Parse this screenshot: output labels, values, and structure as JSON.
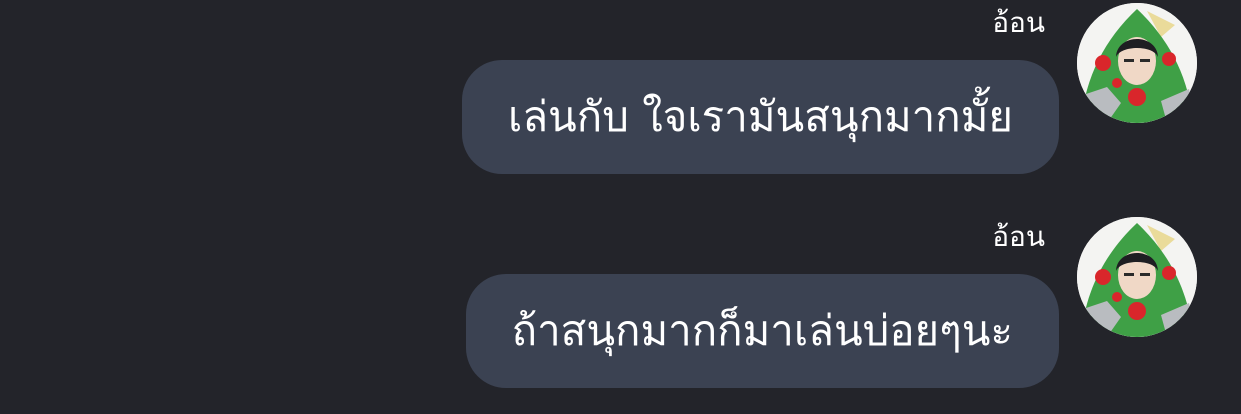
{
  "messages": [
    {
      "sender": "อ้อน",
      "text": "เล่นกับ ใจเรามันสนุกมากมั้ย"
    },
    {
      "sender": "อ้อน",
      "text": "ถ้าสนุกมากก็มาเล่นบ่อยๆนะ"
    }
  ],
  "colors": {
    "background": "#23242a",
    "bubble": "#3b4252",
    "text": "#ffffff"
  }
}
